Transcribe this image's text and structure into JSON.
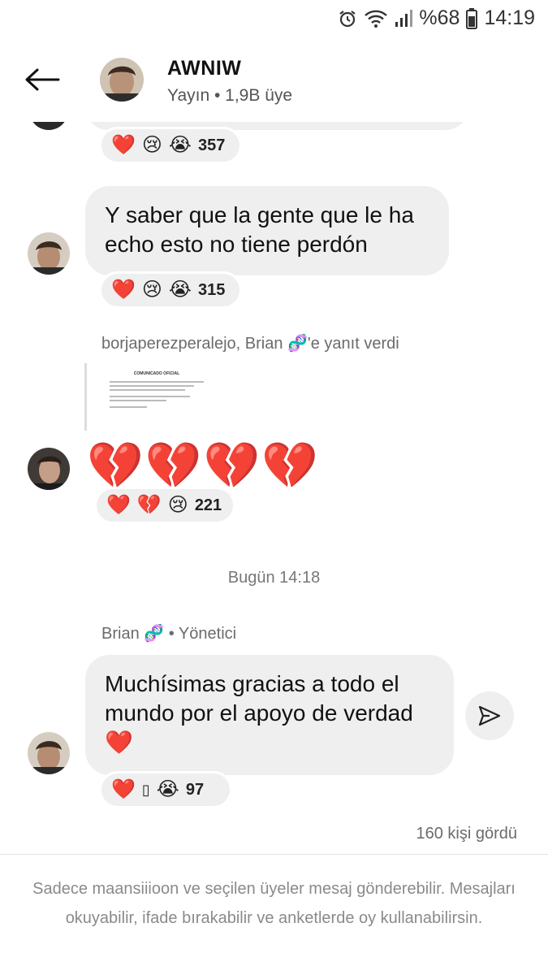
{
  "status_bar": {
    "battery_text": "%68",
    "time": "14:19",
    "icons": [
      "alarm-icon",
      "wifi-icon",
      "signal-icon",
      "battery-icon"
    ]
  },
  "header": {
    "title": "AWNIW",
    "subtitle": "Yayın • 1,9B üye"
  },
  "messages": [
    {
      "reactions": {
        "emojis": [
          "❤️",
          "😢",
          "😭"
        ],
        "count": "357"
      }
    },
    {
      "text": "Y saber que la gente que le ha echo esto no tiene perdón",
      "reactions": {
        "emojis": [
          "❤️",
          "😢",
          "😭"
        ],
        "count": "315"
      }
    },
    {
      "reply_label": "borjaperezperaleјo, Brian 🧬'e yanıt verdi",
      "attachment_title": "COMUNICADO OFICIAL",
      "text": "💔💔💔💔",
      "reactions": {
        "emojis": [
          "❤️",
          "💔",
          "😢"
        ],
        "count": "221"
      }
    }
  ],
  "time_separator": "Bugün 14:18",
  "sender": {
    "name": "Brian",
    "badge_emoji": "🧬",
    "role": "• Yönetici"
  },
  "last_message": {
    "text_line1": "Muchísimas gracias a todo el",
    "text_line2": "mundo por el apoyo de verdad",
    "text_emoji": "❤️",
    "reactions": {
      "emojis": [
        "❤️",
        "▯",
        "😭"
      ],
      "count": "97"
    }
  },
  "seen": "160 kişi gördü",
  "footer_note": "Sadece maansiiioon ve seçilen üyeler mesaj gönderebilir. Mesajları okuyabilir, ifade bırakabilir ve anketlerde oy kullanabilirsin."
}
